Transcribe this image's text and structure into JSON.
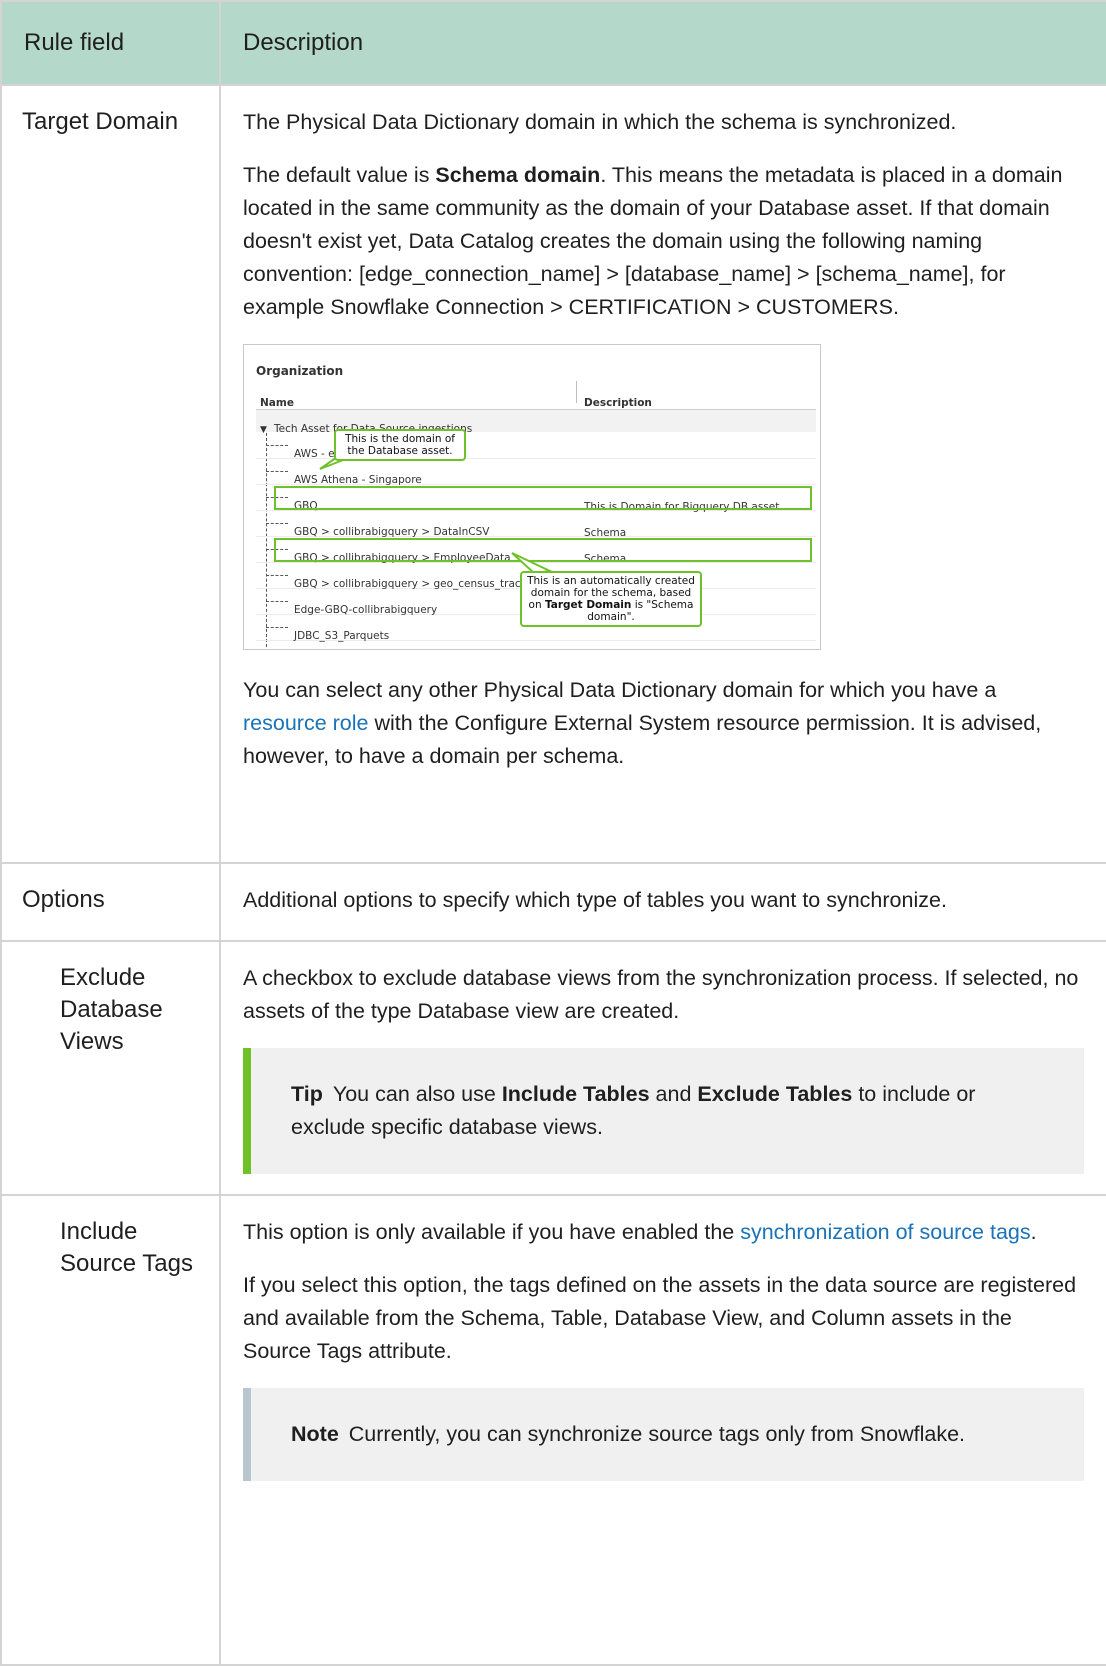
{
  "header": {
    "col1": "Rule field",
    "col2": "Description"
  },
  "rows": {
    "target_domain": {
      "field": "Target Domain",
      "p1": "The Physical Data Dictionary domain in which the schema is synchronized.",
      "p2_pre": "The default value is ",
      "p2_bold": "Schema domain",
      "p2_post": ". This means the metadata is placed in a domain located in the same community as the domain of your Database asset. If that domain doesn't exist yet, Data Catalog creates the domain using the following naming convention: [edge_connection_name] > [database_name] > [schema_name], for example Snowflake Connection > CERTIFICATION > CUSTOMERS.",
      "p3_pre": "You can select any other Physical Data Dictionary domain for which you have a ",
      "p3_link": "resource role",
      "p3_post": " with the Configure External System resource permission. It is advised, however, to have a domain per schema."
    },
    "options": {
      "field": "Options",
      "desc": "Additional options to specify which type of tables you want to synchronize."
    },
    "exclude_views": {
      "field": "Exclude Database Views",
      "desc": "A checkbox to exclude database views from the synchronization process. If selected, no assets of the type Database view are created.",
      "tip_label": "Tip",
      "tip_pre": "You can also use ",
      "tip_b1": "Include Tables",
      "tip_mid": " and ",
      "tip_b2": "Exclude Tables",
      "tip_post": " to include or exclude specific database views."
    },
    "include_tags": {
      "field": "Include Source Tags",
      "p1_pre": "This option is only available if you have enabled the ",
      "p1_link": "synchronization of source tags",
      "p1_post": ".",
      "p2": "If you select this option, the tags defined on the assets in the data source are registered and available from the Schema, Table, Database View, and Column assets in the Source Tags attribute.",
      "note_label": "Note",
      "note_text": "Currently, you can synchronize source tags only from Snowflake."
    }
  },
  "figure": {
    "title": "Organization",
    "col_name": "Name",
    "col_desc": "Description",
    "group": "Tech Asset for Data Source ingestions",
    "items": [
      {
        "name": "AWS - emr",
        "desc": ""
      },
      {
        "name": "AWS Athena - Singapore",
        "desc": ""
      },
      {
        "name": "GBQ",
        "desc": "This is Domain for Bigquery DB asset"
      },
      {
        "name": "GBQ > collibrabigquery > DataInCSV",
        "desc": "Schema"
      },
      {
        "name": "GBQ > collibrabigquery > EmployeeData",
        "desc": "Schema"
      },
      {
        "name": "GBQ > collibrabigquery > geo_census_tracts",
        "desc": ""
      },
      {
        "name": "Edge-GBQ-collibrabigquery",
        "desc": ""
      },
      {
        "name": "JDBC_S3_Parquets",
        "desc": ""
      }
    ],
    "callout1": "This is the domain of the Database asset.",
    "callout2_pre": "This is an automatically created domain for the schema, based on ",
    "callout2_bold": "Target Domain",
    "callout2_post": " is \"Schema domain\".",
    "accent_color": "#6fc12a"
  },
  "colors": {
    "header_bg": "#b4d8c9",
    "tip_bar": "#6fc12a",
    "note_bar": "#b8c6cf",
    "link": "#1a73b8"
  }
}
